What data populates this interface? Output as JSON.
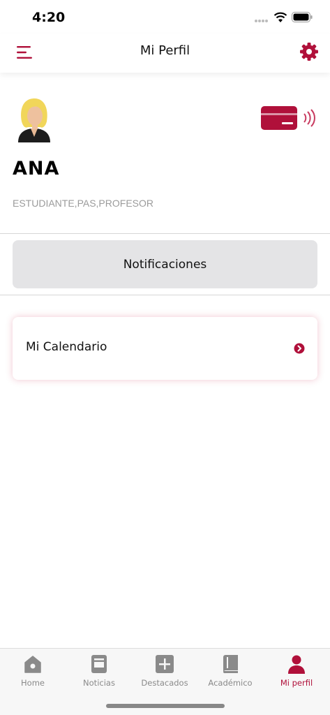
{
  "status_bar": {
    "time": "4:20"
  },
  "header": {
    "title": "Mi Perfil"
  },
  "profile": {
    "name": "ANA",
    "roles": "ESTUDIANTE,PAS,PROFESOR"
  },
  "notifications_button": {
    "label": "Notificaciones"
  },
  "calendar_card": {
    "label": "Mi Calendario"
  },
  "tab_bar": {
    "items": [
      {
        "label": "Home",
        "icon": "home-icon"
      },
      {
        "label": "Noticias",
        "icon": "news-icon"
      },
      {
        "label": "Destacados",
        "icon": "plus-icon"
      },
      {
        "label": "Académico",
        "icon": "book-icon"
      },
      {
        "label": "Mi perfil",
        "icon": "person-icon",
        "active": true
      }
    ]
  },
  "colors": {
    "accent": "#b0103a",
    "background": "#ffffff",
    "button_gray": "#e4e4e6"
  }
}
